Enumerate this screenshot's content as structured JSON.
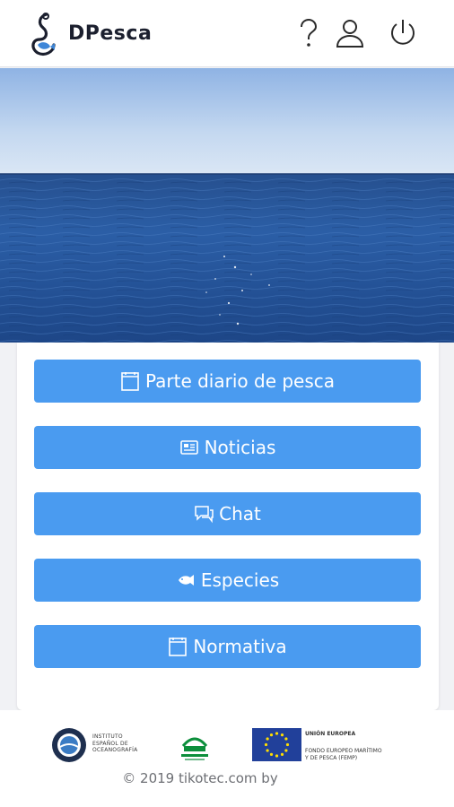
{
  "header": {
    "brand": "DPesca",
    "icons": [
      "fish-hook-logo-icon",
      "help-icon",
      "user-icon",
      "power-icon"
    ]
  },
  "hero": {
    "image": "calm-blue-sea-photo"
  },
  "menu": {
    "items": [
      {
        "label": "Parte diario de pesca",
        "icon": "calendar-icon"
      },
      {
        "label": "Noticias",
        "icon": "newspaper-icon"
      },
      {
        "label": "Chat",
        "icon": "chat-bubbles-icon"
      },
      {
        "label": "Especies",
        "icon": "fish-icon"
      },
      {
        "label": "Normativa",
        "icon": "calendar-icon"
      }
    ],
    "button_color": "#4a9bf0"
  },
  "footer": {
    "ieo": {
      "line1": "INSTITUTO",
      "line2": "ESPAÑOL DE",
      "line3": "OCEANOGRAFÍA"
    },
    "eu": {
      "title": "UNIÓN EUROPEA",
      "line1": "FONDO EUROPEO MARÍTIMO",
      "line2": "Y DE PESCA (FEMP)"
    },
    "copyright": "© 2019 tikotec.com by"
  }
}
